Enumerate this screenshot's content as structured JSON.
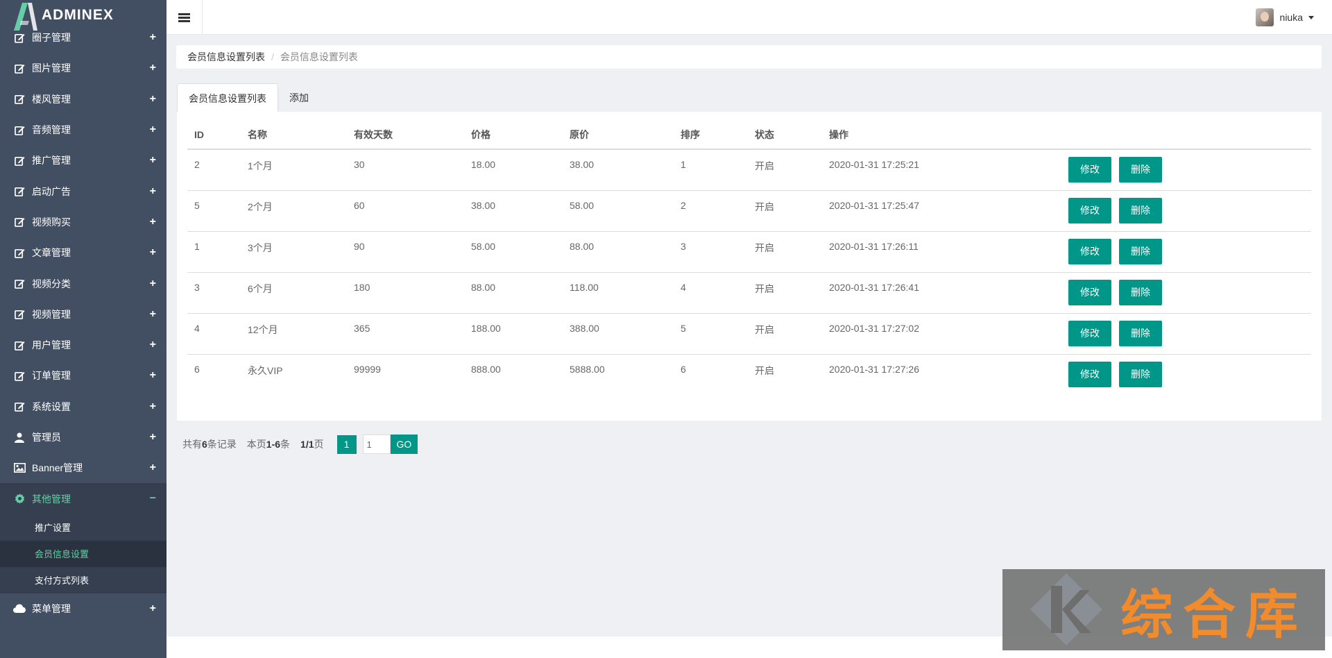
{
  "app": {
    "name": "ADMINEX"
  },
  "sidebar": {
    "items": [
      {
        "label": "圈子管理",
        "icon": "edit-icon"
      },
      {
        "label": "图片管理",
        "icon": "edit-icon"
      },
      {
        "label": "楼风管理",
        "icon": "edit-icon"
      },
      {
        "label": "音频管理",
        "icon": "edit-icon"
      },
      {
        "label": "推广管理",
        "icon": "edit-icon"
      },
      {
        "label": "启动广告",
        "icon": "edit-icon"
      },
      {
        "label": "视频购买",
        "icon": "edit-icon"
      },
      {
        "label": "文章管理",
        "icon": "edit-icon"
      },
      {
        "label": "视频分类",
        "icon": "edit-icon"
      },
      {
        "label": "视频管理",
        "icon": "edit-icon"
      },
      {
        "label": "用户管理",
        "icon": "edit-icon"
      },
      {
        "label": "订单管理",
        "icon": "edit-icon"
      },
      {
        "label": "系统设置",
        "icon": "edit-icon"
      },
      {
        "label": "管理员",
        "icon": "user-icon"
      },
      {
        "label": "Banner管理",
        "icon": "image-icon"
      }
    ],
    "active_group": {
      "label": "其他管理",
      "icon": "gear-icon",
      "children": [
        {
          "label": "推广设置"
        },
        {
          "label": "会员信息设置"
        },
        {
          "label": "支付方式列表"
        }
      ]
    },
    "last_item": {
      "label": "菜单管理",
      "icon": "cloud-icon"
    }
  },
  "header": {
    "username": "niuka"
  },
  "breadcrumb": {
    "parent": "会员信息设置列表",
    "current": "会员信息设置列表"
  },
  "tabs": [
    {
      "label": "会员信息设置列表"
    },
    {
      "label": "添加"
    }
  ],
  "table": {
    "headers": [
      "ID",
      "名称",
      "有效天数",
      "价格",
      "原价",
      "排序",
      "状态",
      "操作"
    ],
    "rows": [
      {
        "id": "2",
        "name": "1个月",
        "days": "30",
        "price": "18.00",
        "original": "38.00",
        "sort": "1",
        "status": "开启",
        "time": "2020-01-31 17:25:21"
      },
      {
        "id": "5",
        "name": "2个月",
        "days": "60",
        "price": "38.00",
        "original": "58.00",
        "sort": "2",
        "status": "开启",
        "time": "2020-01-31 17:25:47"
      },
      {
        "id": "1",
        "name": "3个月",
        "days": "90",
        "price": "58.00",
        "original": "88.00",
        "sort": "3",
        "status": "开启",
        "time": "2020-01-31 17:26:11"
      },
      {
        "id": "3",
        "name": "6个月",
        "days": "180",
        "price": "88.00",
        "original": "118.00",
        "sort": "4",
        "status": "开启",
        "time": "2020-01-31 17:26:41"
      },
      {
        "id": "4",
        "name": "12个月",
        "days": "365",
        "price": "188.00",
        "original": "388.00",
        "sort": "5",
        "status": "开启",
        "time": "2020-01-31 17:27:02"
      },
      {
        "id": "6",
        "name": "永久VIP",
        "days": "99999",
        "price": "888.00",
        "original": "5888.00",
        "sort": "6",
        "status": "开启",
        "time": "2020-01-31 17:27:26"
      }
    ],
    "edit_label": "修改",
    "delete_label": "删除"
  },
  "pager": {
    "total_prefix": "共有",
    "total": "6",
    "total_suffix": "条记录",
    "page_prefix": "本页",
    "page_range": "1-6",
    "page_suffix": "条",
    "pages": "1/1",
    "pages_suffix": "页",
    "current": "1",
    "input_value": "1",
    "go_label": "GO"
  },
  "watermark": {
    "text": "综合库"
  },
  "colors": {
    "sidebar": "#424f63",
    "accent": "#009688",
    "active_text": "#65cea7"
  }
}
